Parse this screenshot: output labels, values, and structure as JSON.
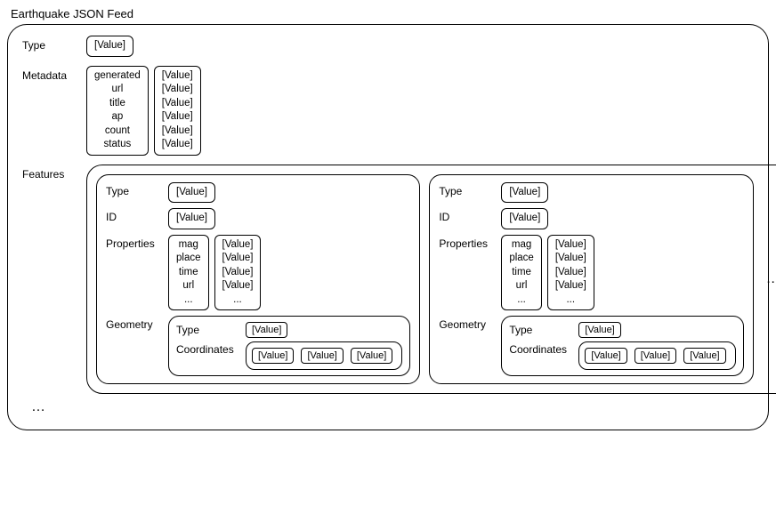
{
  "title": "Earthquake JSON Feed",
  "value_placeholder": "[Value]",
  "ellipsis": "...",
  "side_ellipsis": "…",
  "sections": {
    "type": "Type",
    "metadata": "Metadata",
    "features": "Features"
  },
  "metadata_keys": [
    "generated",
    "url",
    "title",
    "ap",
    "count",
    "status"
  ],
  "feature": {
    "type": "Type",
    "id": "ID",
    "properties": "Properties",
    "property_keys": [
      "mag",
      "place",
      "time",
      "url",
      "..."
    ],
    "geometry": "Geometry",
    "geom_type": "Type",
    "coordinates": "Coordinates"
  }
}
